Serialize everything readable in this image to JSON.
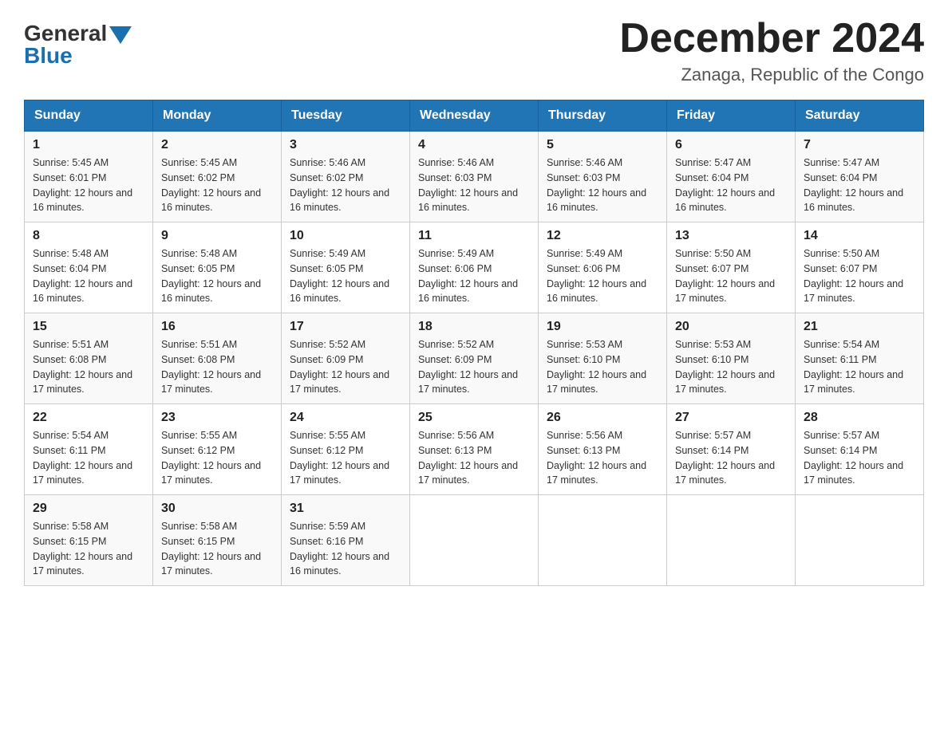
{
  "header": {
    "logo_general": "General",
    "logo_blue": "Blue",
    "month_title": "December 2024",
    "location": "Zanaga, Republic of the Congo"
  },
  "days_of_week": [
    "Sunday",
    "Monday",
    "Tuesday",
    "Wednesday",
    "Thursday",
    "Friday",
    "Saturday"
  ],
  "weeks": [
    [
      {
        "day": "1",
        "sunrise": "5:45 AM",
        "sunset": "6:01 PM",
        "daylight": "12 hours and 16 minutes."
      },
      {
        "day": "2",
        "sunrise": "5:45 AM",
        "sunset": "6:02 PM",
        "daylight": "12 hours and 16 minutes."
      },
      {
        "day": "3",
        "sunrise": "5:46 AM",
        "sunset": "6:02 PM",
        "daylight": "12 hours and 16 minutes."
      },
      {
        "day": "4",
        "sunrise": "5:46 AM",
        "sunset": "6:03 PM",
        "daylight": "12 hours and 16 minutes."
      },
      {
        "day": "5",
        "sunrise": "5:46 AM",
        "sunset": "6:03 PM",
        "daylight": "12 hours and 16 minutes."
      },
      {
        "day": "6",
        "sunrise": "5:47 AM",
        "sunset": "6:04 PM",
        "daylight": "12 hours and 16 minutes."
      },
      {
        "day": "7",
        "sunrise": "5:47 AM",
        "sunset": "6:04 PM",
        "daylight": "12 hours and 16 minutes."
      }
    ],
    [
      {
        "day": "8",
        "sunrise": "5:48 AM",
        "sunset": "6:04 PM",
        "daylight": "12 hours and 16 minutes."
      },
      {
        "day": "9",
        "sunrise": "5:48 AM",
        "sunset": "6:05 PM",
        "daylight": "12 hours and 16 minutes."
      },
      {
        "day": "10",
        "sunrise": "5:49 AM",
        "sunset": "6:05 PM",
        "daylight": "12 hours and 16 minutes."
      },
      {
        "day": "11",
        "sunrise": "5:49 AM",
        "sunset": "6:06 PM",
        "daylight": "12 hours and 16 minutes."
      },
      {
        "day": "12",
        "sunrise": "5:49 AM",
        "sunset": "6:06 PM",
        "daylight": "12 hours and 16 minutes."
      },
      {
        "day": "13",
        "sunrise": "5:50 AM",
        "sunset": "6:07 PM",
        "daylight": "12 hours and 17 minutes."
      },
      {
        "day": "14",
        "sunrise": "5:50 AM",
        "sunset": "6:07 PM",
        "daylight": "12 hours and 17 minutes."
      }
    ],
    [
      {
        "day": "15",
        "sunrise": "5:51 AM",
        "sunset": "6:08 PM",
        "daylight": "12 hours and 17 minutes."
      },
      {
        "day": "16",
        "sunrise": "5:51 AM",
        "sunset": "6:08 PM",
        "daylight": "12 hours and 17 minutes."
      },
      {
        "day": "17",
        "sunrise": "5:52 AM",
        "sunset": "6:09 PM",
        "daylight": "12 hours and 17 minutes."
      },
      {
        "day": "18",
        "sunrise": "5:52 AM",
        "sunset": "6:09 PM",
        "daylight": "12 hours and 17 minutes."
      },
      {
        "day": "19",
        "sunrise": "5:53 AM",
        "sunset": "6:10 PM",
        "daylight": "12 hours and 17 minutes."
      },
      {
        "day": "20",
        "sunrise": "5:53 AM",
        "sunset": "6:10 PM",
        "daylight": "12 hours and 17 minutes."
      },
      {
        "day": "21",
        "sunrise": "5:54 AM",
        "sunset": "6:11 PM",
        "daylight": "12 hours and 17 minutes."
      }
    ],
    [
      {
        "day": "22",
        "sunrise": "5:54 AM",
        "sunset": "6:11 PM",
        "daylight": "12 hours and 17 minutes."
      },
      {
        "day": "23",
        "sunrise": "5:55 AM",
        "sunset": "6:12 PM",
        "daylight": "12 hours and 17 minutes."
      },
      {
        "day": "24",
        "sunrise": "5:55 AM",
        "sunset": "6:12 PM",
        "daylight": "12 hours and 17 minutes."
      },
      {
        "day": "25",
        "sunrise": "5:56 AM",
        "sunset": "6:13 PM",
        "daylight": "12 hours and 17 minutes."
      },
      {
        "day": "26",
        "sunrise": "5:56 AM",
        "sunset": "6:13 PM",
        "daylight": "12 hours and 17 minutes."
      },
      {
        "day": "27",
        "sunrise": "5:57 AM",
        "sunset": "6:14 PM",
        "daylight": "12 hours and 17 minutes."
      },
      {
        "day": "28",
        "sunrise": "5:57 AM",
        "sunset": "6:14 PM",
        "daylight": "12 hours and 17 minutes."
      }
    ],
    [
      {
        "day": "29",
        "sunrise": "5:58 AM",
        "sunset": "6:15 PM",
        "daylight": "12 hours and 17 minutes."
      },
      {
        "day": "30",
        "sunrise": "5:58 AM",
        "sunset": "6:15 PM",
        "daylight": "12 hours and 17 minutes."
      },
      {
        "day": "31",
        "sunrise": "5:59 AM",
        "sunset": "6:16 PM",
        "daylight": "12 hours and 16 minutes."
      },
      null,
      null,
      null,
      null
    ]
  ]
}
